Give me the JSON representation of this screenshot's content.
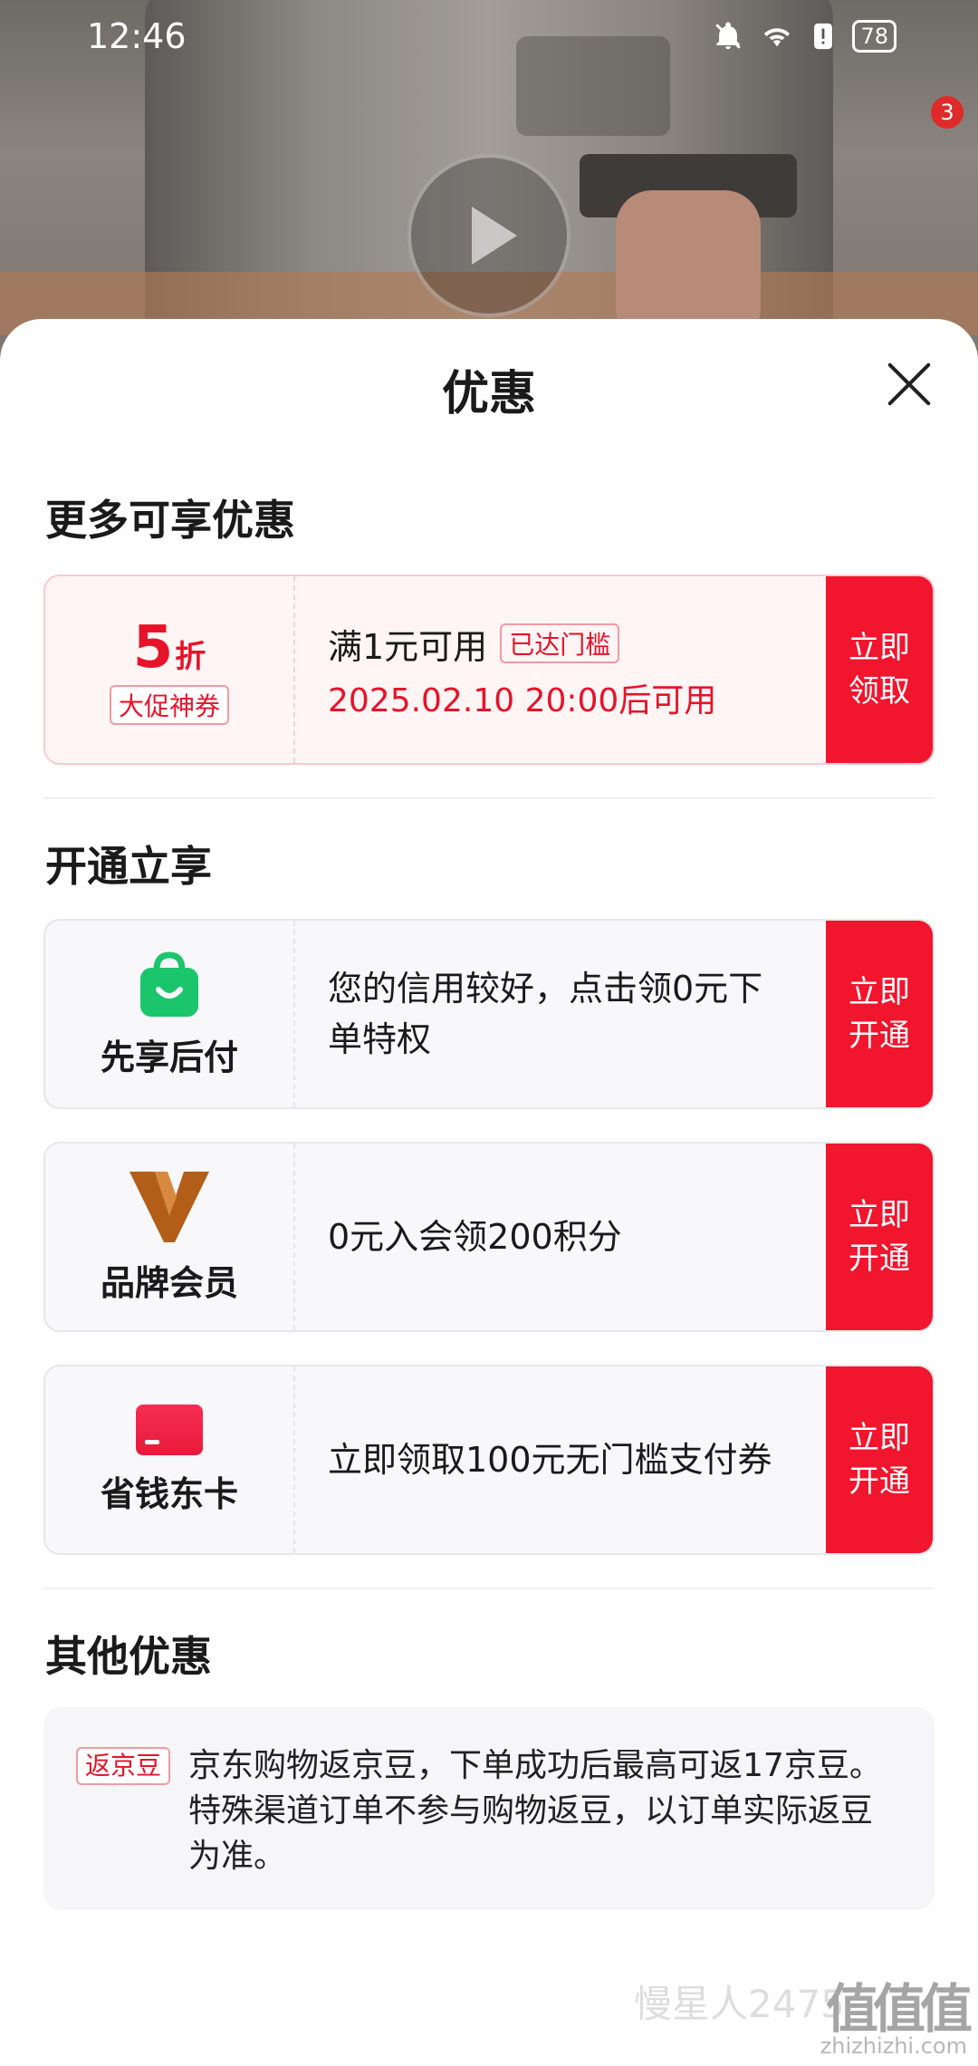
{
  "status_bar": {
    "time": "12:46",
    "battery": "78"
  },
  "video": {
    "badge_count": "3"
  },
  "sheet": {
    "title": "优惠",
    "sections": {
      "more": {
        "title": "更多可享优惠"
      },
      "open": {
        "title": "开通立享"
      },
      "other": {
        "title": "其他优惠"
      }
    },
    "coupon": {
      "discount_value": "5",
      "discount_unit": "折",
      "tag": "大促神券",
      "condition": "满1元可用",
      "reached_label": "已达门槛",
      "valid_time": "2025.02.10 20:00后可用",
      "action": "立即领取"
    },
    "services": [
      {
        "name": "先享后付",
        "icon": "shopping-bag-icon",
        "desc": "您的信用较好，点击领0元下单特权",
        "action": "立即开通"
      },
      {
        "name": "品牌会员",
        "icon": "brand-v-icon",
        "desc": "0元入会领200积分",
        "action": "立即开通"
      },
      {
        "name": "省钱东卡",
        "icon": "card-icon",
        "desc": "立即领取100元无门槛支付券",
        "action": "立即开通"
      }
    ],
    "other_offer": {
      "tag": "返京豆",
      "text": "京东购物返京豆，下单成功后最高可返17京豆。特殊渠道订单不参与购物返豆，以订单实际返豆为准。"
    }
  },
  "watermark": {
    "left": "慢星人2475",
    "right": "值值值",
    "url": "zhizhizhi.com"
  },
  "colors": {
    "accent": "#f1152d",
    "coupon_bg": "#fff5f5",
    "service_green": "#1bc56b",
    "brand_brown": "#b35e18"
  }
}
